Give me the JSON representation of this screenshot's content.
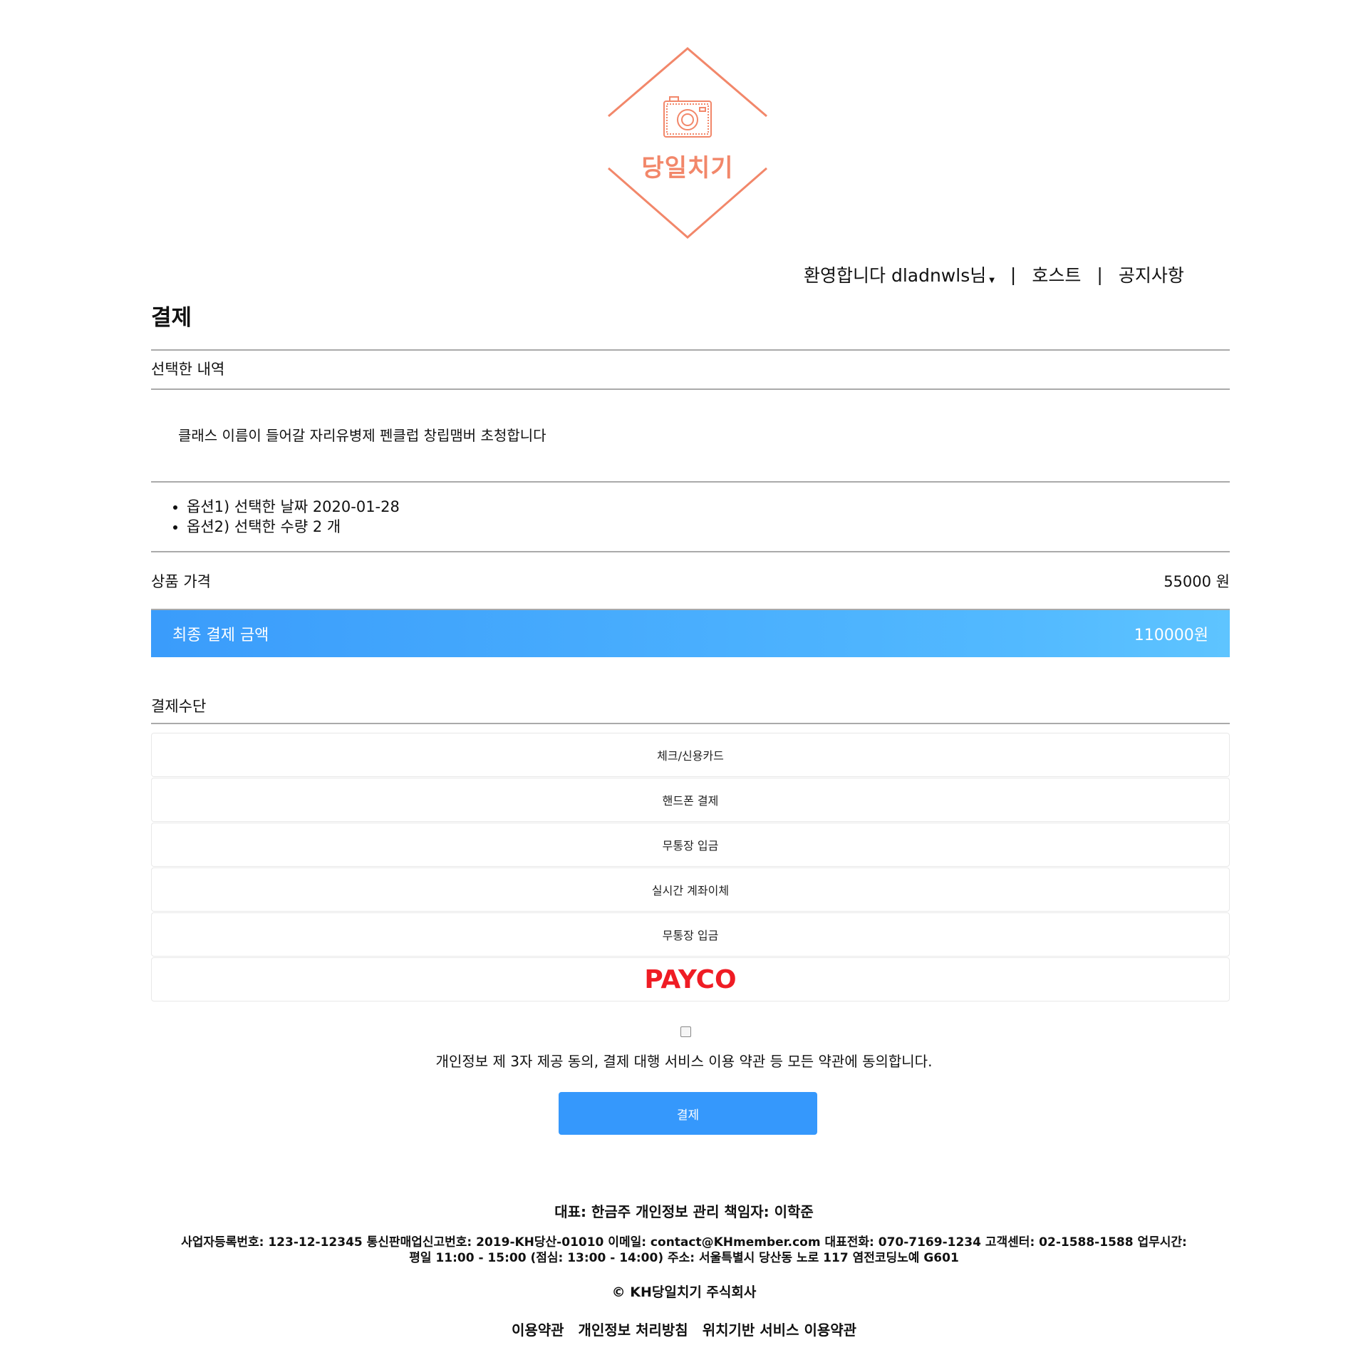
{
  "brand": {
    "logo_text": "당일치기",
    "accent_color": "#f2876a",
    "logo_icon": "camera-icon"
  },
  "nav": {
    "welcome": "환영합니다 dladnwls님",
    "separator": "|",
    "host": "호스트",
    "notice": "공지사항"
  },
  "page": {
    "title": "결제",
    "selected_label": "선택한 내역",
    "class_name": "클래스 이름이 들어갈 자리유병제 펜클럽 창립맴버 초청합니다",
    "options": [
      "옵션1) 선택한 날짜 2020-01-28",
      "옵션2) 선택한 수량 2 개"
    ],
    "price_label": "상품 가격",
    "price_value": "55000 원",
    "final_label": "최종 결제 금액",
    "final_value": "110000원",
    "method_label": "결제수단",
    "methods": [
      "체크/신용카드",
      "핸드폰 결제",
      "무통장 입금",
      "실시간 계좌이체",
      "무통장 입금"
    ],
    "payco_label": "PAYCO",
    "agree_text": "개인정보 제 3자 제공 동의, 결제 대행 서비스 이용 약관 등 모든 약관에 동의합니다.",
    "agree_checked": false,
    "pay_button": "결제"
  },
  "footer": {
    "rep": "대표: 한금주 개인정보 관리 책임자: 이학준",
    "biz_info": "사업자등록번호: 123-12-12345 통신판매업신고번호: 2019-KH당산-01010 이메일: contact@KHmember.com 대표전화: 070-7169-1234 고객센터: 02-1588-1588 업무시간: 평일 11:00 - 15:00 (점심: 13:00 - 14:00) 주소: 서울특별시 당산동 노로 117 염전코딩노예 G601",
    "copyright": "© KH당일치기 주식회사",
    "links": [
      "이용약관",
      "개인정보 처리방침",
      "위치기반 서비스 이용약관"
    ]
  },
  "colors": {
    "primary": "#3598fc",
    "final_gradient_start": "#3a9cfb",
    "final_gradient_end": "#5ec4ff",
    "payco": "#ef1c24"
  }
}
